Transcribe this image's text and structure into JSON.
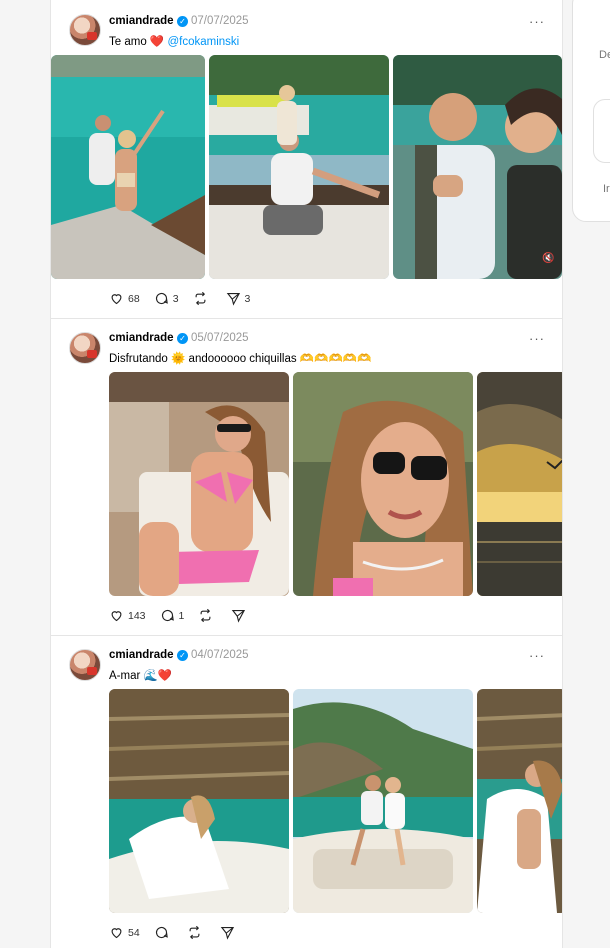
{
  "right_panel": {
    "label_top": "De",
    "label_bottom": "Ir"
  },
  "posts": [
    {
      "username": "cmiandrade",
      "date": "07/07/2025",
      "caption_text": "Te amo",
      "caption_heart": "❤️",
      "caption_mention": "@fcokaminski",
      "likes": "68",
      "comments": "3",
      "reposts": "",
      "shares": "3",
      "photos": [
        "boat-couple-photo",
        "boat-couple-seated-photo",
        "couple-selfie-video"
      ]
    },
    {
      "username": "cmiandrade",
      "date": "05/07/2025",
      "caption_text": "Disfrutando",
      "caption_sun": "🌞",
      "caption_rest": "andoooooo chiquillas 🫶🫶🫶🫶🫶",
      "likes": "143",
      "comments": "1",
      "reposts": "",
      "shares": "",
      "photos": [
        "bikini-pose-photo",
        "sunglasses-closeup-photo",
        "sunset-sea-photo"
      ]
    },
    {
      "username": "cmiandrade",
      "date": "04/07/2025",
      "caption_text": "A-mar",
      "caption_wave": "🌊",
      "caption_heart": "❤️",
      "likes": "54",
      "comments": "",
      "reposts": "",
      "shares": "",
      "photos": [
        "boat-cliffs-photo",
        "boat-couple-bay-photo",
        "white-shirt-cliffs-photo"
      ]
    }
  ],
  "colors": {
    "accent_blue": "#0095f6",
    "heart_red": "#e0162b",
    "border": "#e5e5e5",
    "muted_text": "#999999"
  }
}
